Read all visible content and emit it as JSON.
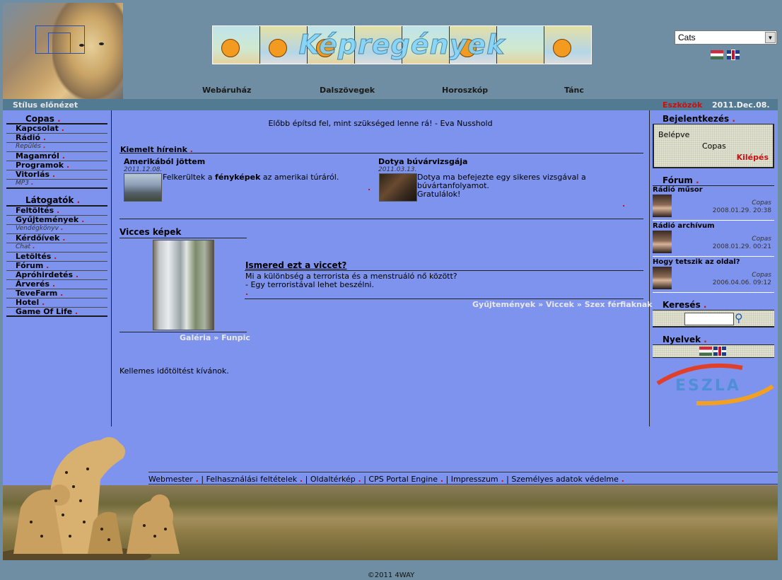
{
  "header": {
    "banner_title": "Képregények",
    "lang_select_value": "Cats",
    "nav": [
      "Webáruház",
      "Dalszövegek",
      "Horoszkóp",
      "Tánc"
    ]
  },
  "bar": {
    "style_preview": "Stílus előnézet",
    "tools": "Eszközök",
    "date": "2011.Dec.08."
  },
  "left": {
    "copas_title": "Copas",
    "copas_items": [
      {
        "label": "Kapcsolat",
        "small": false
      },
      {
        "label": "Rádió",
        "small": false
      },
      {
        "label": "Repülés",
        "small": true
      },
      {
        "label": "Magamról",
        "small": false
      },
      {
        "label": "Programok",
        "small": false
      },
      {
        "label": "Vitorlás",
        "small": false
      },
      {
        "label": "MP3",
        "small": true
      }
    ],
    "visitors_title": "Látogatók",
    "visitor_items": [
      {
        "label": "Feltöltés",
        "small": false
      },
      {
        "label": "Gyűjtemények",
        "small": false
      },
      {
        "label": "Vendégkönyv",
        "small": true
      },
      {
        "label": "Kérdőívek",
        "small": false
      },
      {
        "label": "Chat",
        "small": true
      },
      {
        "label": "Letöltés",
        "small": false
      },
      {
        "label": "Fórum",
        "small": false
      },
      {
        "label": "Apróhirdetés",
        "small": false
      },
      {
        "label": "Árverés",
        "small": false
      },
      {
        "label": "TeveFarm",
        "small": false
      },
      {
        "label": "Hotel",
        "small": false
      },
      {
        "label": "Game Of Life",
        "small": false
      }
    ]
  },
  "center": {
    "quote": "Előbb építsd fel, mint szükséged lenne rá! - Eva Nusshold",
    "featured_title": "Kiemelt híreink",
    "news": [
      {
        "title": "Amerikából jöttem",
        "date": "2011.12.08.",
        "text_pre": "Felkerültek a ",
        "text_bold": "fényképek",
        "text_post": " az amerikai túráról."
      },
      {
        "title": "Dotya búvárvizsgája",
        "date": "2011.03.13.",
        "text_pre": "Dotya ma befejezte egy sikeres vizsgával a búvártanfolyamot.",
        "text_bold": "",
        "text_post": "Gratulálok!"
      }
    ],
    "funny_title": "Vicces képek",
    "gallery_link": "Galéria",
    "gallery_sep": "»",
    "funpic_link": "Funpic",
    "joke_title": "Ismered ezt a viccet?",
    "joke_q": "Mi a különbség a terrorista és a menstruáló nő között?",
    "joke_a": "- Egy terroristával lehet beszélni.",
    "joke_crumbs": [
      "Gyűjtemények",
      "Viccek",
      "Szex férfiaknak"
    ],
    "joke_sep": "»",
    "goodbye": "Kellemes időtöltést kívánok."
  },
  "right": {
    "login_title": "Bejelentkezés",
    "logged_in": "Belépve",
    "user": "Copas",
    "logout": "Kilépés",
    "forum_title": "Fórum",
    "forum": [
      {
        "title": "Rádió műsor",
        "author": "Copas",
        "date": "2008.01.29. 20:38"
      },
      {
        "title": "Rádió archívum",
        "author": "Copas",
        "date": "2008.01.29. 00:21"
      },
      {
        "title": "Hogy tetszik az oldal?",
        "author": "Copas",
        "date": "2006.04.06. 09:12"
      }
    ],
    "search_title": "Keresés",
    "lang_title": "Nyelvek",
    "eszla_logo": "ESZLA"
  },
  "footer": {
    "links": [
      "Webmester",
      "Felhasználási feltételek",
      "Oldaltérkép",
      "CPS Portal Engine",
      "Impresszum",
      "Személyes adatok védelme"
    ],
    "copyright": "©2011 4WAY"
  },
  "colors": {
    "accent_red": "#c81010",
    "main_bg": "#7e93ee",
    "page_bg": "#6f8ea3"
  }
}
